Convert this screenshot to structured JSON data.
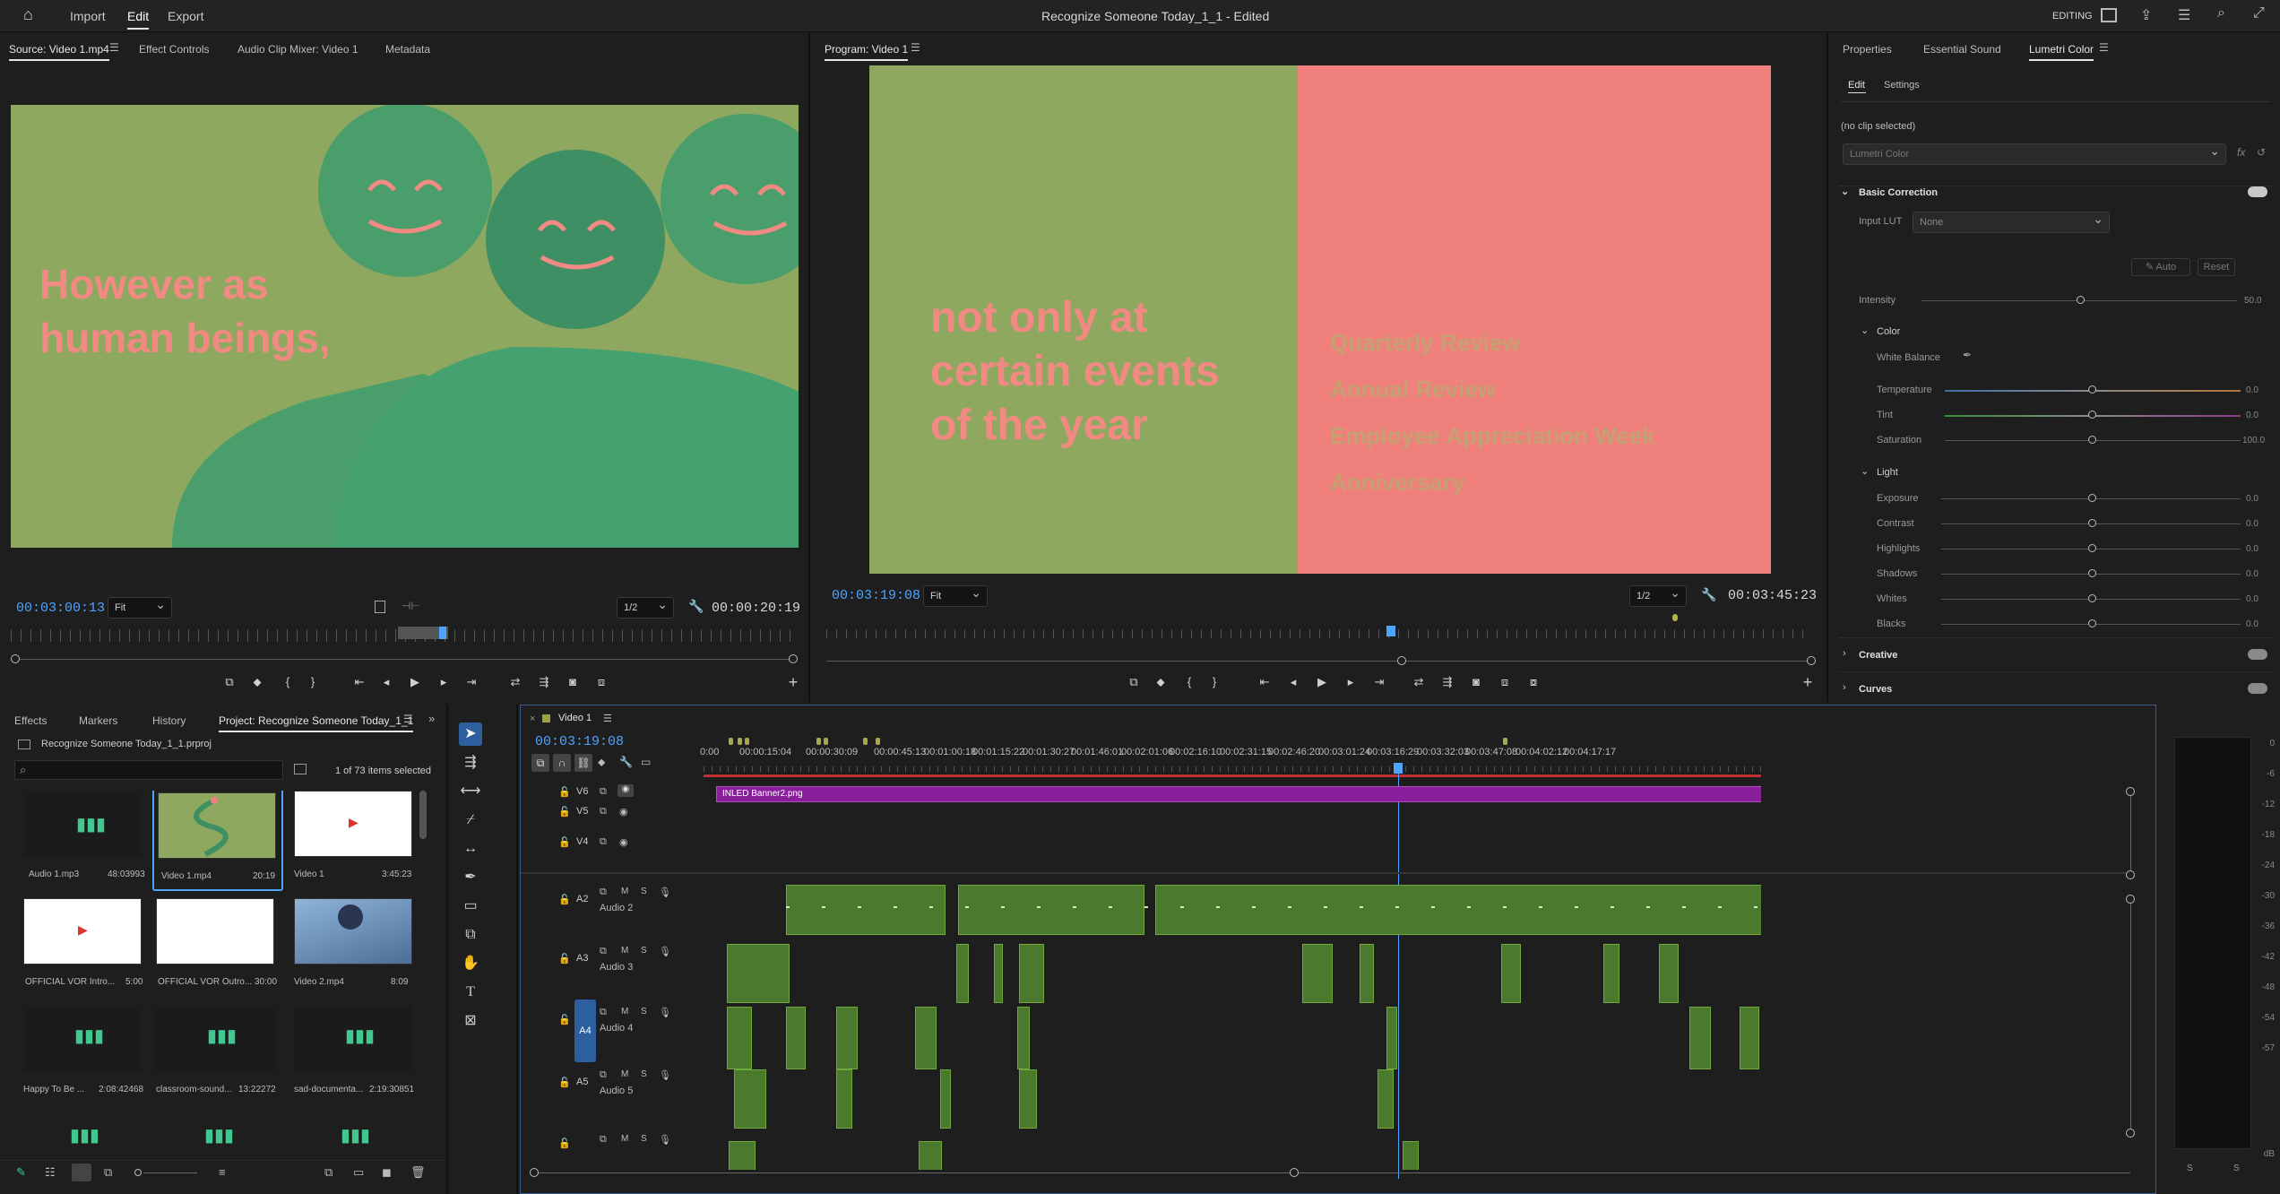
{
  "topbar": {
    "menu": [
      "Import",
      "Edit",
      "Export"
    ],
    "title": "Recognize Someone Today_1_1 - Edited",
    "workspace": "EDITING"
  },
  "source": {
    "tabs": [
      "Source: Video 1.mp4",
      "Effect Controls",
      "Audio Clip Mixer: Video 1",
      "Metadata"
    ],
    "timecode_left": "00:03:00:13",
    "fit": "Fit",
    "quality": "1/2",
    "timecode_right": "00:00:20:19",
    "frame_text": "However as\nhuman beings,"
  },
  "program": {
    "tab": "Program: Video 1",
    "timecode_left": "00:03:19:08",
    "fit": "Fit",
    "quality": "1/2",
    "timecode_right": "00:03:45:23",
    "left_text": "not only at\ncertain events\nof the year",
    "right_list": [
      "Quarterly Review",
      "Annual Review",
      "Employee Appreciation Week",
      "Anniversary"
    ]
  },
  "lumetri": {
    "tabs": [
      "Properties",
      "Essential Sound",
      "Lumetri Color"
    ],
    "subtabs": [
      "Edit",
      "Settings"
    ],
    "no_clip": "(no clip selected)",
    "effect_dropdown": "Lumetri Color",
    "basic_correction": "Basic Correction",
    "input_lut_label": "Input LUT",
    "input_lut_value": "None",
    "auto": "Auto",
    "reset": "Reset",
    "intensity_label": "Intensity",
    "intensity_value": "50.0",
    "color_section": "Color",
    "white_balance": "White Balance",
    "color_sliders": [
      {
        "label": "Temperature",
        "value": "0.0"
      },
      {
        "label": "Tint",
        "value": "0.0"
      },
      {
        "label": "Saturation",
        "value": "100.0"
      }
    ],
    "light_section": "Light",
    "light_sliders": [
      {
        "label": "Exposure",
        "value": "0.0"
      },
      {
        "label": "Contrast",
        "value": "0.0"
      },
      {
        "label": "Highlights",
        "value": "0.0"
      },
      {
        "label": "Shadows",
        "value": "0.0"
      },
      {
        "label": "Whites",
        "value": "0.0"
      },
      {
        "label": "Blacks",
        "value": "0.0"
      }
    ],
    "creative": "Creative",
    "curves": "Curves"
  },
  "project": {
    "tabs": [
      "Effects",
      "Markers",
      "History",
      "Project: Recognize Someone Today_1_1"
    ],
    "file": "Recognize Someone Today_1_1.prproj",
    "selected": "1 of 73 items selected",
    "items": [
      {
        "name": "Audio 1.mp3",
        "duration": "48:03993",
        "kind": "audio"
      },
      {
        "name": "Video 1.mp4",
        "duration": "20:19",
        "kind": "video-green"
      },
      {
        "name": "Video 1",
        "duration": "3:45:23",
        "kind": "video-white"
      },
      {
        "name": "OFFICIAL VOR Intro...",
        "duration": "5:00",
        "kind": "video-white"
      },
      {
        "name": "OFFICIAL VOR Outro...",
        "duration": "30:00",
        "kind": "video-blank"
      },
      {
        "name": "Video 2.mp4",
        "duration": "8:09",
        "kind": "video-photo"
      },
      {
        "name": "Happy To Be ...",
        "duration": "2:08:42468",
        "kind": "audio"
      },
      {
        "name": "classroom-sound...",
        "duration": "13:22272",
        "kind": "audio"
      },
      {
        "name": "sad-documenta...",
        "duration": "2:19:30851",
        "kind": "audio"
      }
    ]
  },
  "timeline": {
    "sequence": "Video 1",
    "timecode": "00:03:19:08",
    "ruler": [
      "0:00",
      "00:00:15:04",
      "00:00:30:09",
      "00:00:45:13",
      "00:01:00:18",
      "00:01:15:22",
      "00:01:30:27",
      "00:01:46:01",
      "00:02:01:06",
      "00:02:16:10",
      "00:02:31:15",
      "00:02:46:20",
      "00:03:01:24",
      "00:03:16:29",
      "00:03:32:03",
      "00:03:47:08",
      "00:04:02:12",
      "00:04:17:17"
    ],
    "video_tracks": [
      "V6",
      "V5",
      "V4"
    ],
    "audio_tracks": [
      {
        "id": "A2",
        "name": "Audio 2"
      },
      {
        "id": "A3",
        "name": "Audio 3"
      },
      {
        "id": "A4",
        "name": "Audio 4"
      },
      {
        "id": "A5",
        "name": "Audio 5"
      }
    ],
    "banner_clip": "INLED Banner2.png"
  },
  "meter": {
    "scale": [
      "0",
      "-6",
      "-12",
      "-18",
      "-24",
      "-30",
      "-36",
      "-42",
      "-48",
      "-54",
      "-57",
      "dB"
    ],
    "bottom": [
      "S",
      "S"
    ]
  }
}
